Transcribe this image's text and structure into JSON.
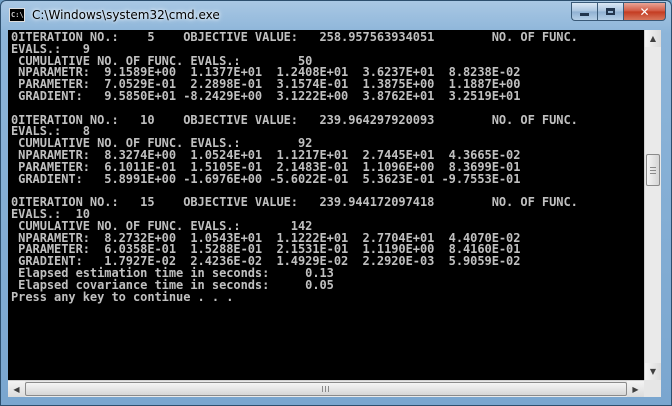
{
  "window": {
    "title": "C:\\Windows\\system32\\cmd.exe",
    "icon_label": "C:\\"
  },
  "controls": {
    "minimize": "minimize-icon",
    "maximize": "maximize-icon",
    "close": "close-icon"
  },
  "console": {
    "lines": [
      "0ITERATION NO.:    5    OBJECTIVE VALUE:   258.957563934051        NO. OF FUNC.",
      "EVALS.:   9",
      " CUMULATIVE NO. OF FUNC. EVALS.:        50",
      " NPARAMETR:  9.1589E+00  1.1377E+01  1.2408E+01  3.6237E+01  8.8238E-02",
      " PARAMETER:  7.0529E-01  2.2898E-01  3.1574E-01  1.3875E+00  1.1887E+00",
      " GRADIENT:   9.5850E+01 -8.2429E+00  3.1222E+00  3.8762E+01  3.2519E+01",
      "",
      "0ITERATION NO.:   10    OBJECTIVE VALUE:   239.964297920093        NO. OF FUNC.",
      "EVALS.:   8",
      " CUMULATIVE NO. OF FUNC. EVALS.:        92",
      " NPARAMETR:  8.3274E+00  1.0524E+01  1.1217E+01  2.7445E+01  4.3665E-02",
      " PARAMETER:  6.1011E-01  1.5105E-01  2.1483E-01  1.1096E+00  8.3699E-01",
      " GRADIENT:   5.8991E+00 -1.6976E+00 -5.6022E-01  5.3623E-01 -9.7553E-01",
      "",
      "0ITERATION NO.:   15    OBJECTIVE VALUE:   239.944172097418        NO. OF FUNC.",
      "EVALS.:  10",
      " CUMULATIVE NO. OF FUNC. EVALS.:       142",
      " NPARAMETR:  8.2732E+00  1.0543E+01  1.1222E+01  2.7704E+01  4.4070E-02",
      " PARAMETER:  6.0358E-01  1.5288E-01  2.1531E-01  1.1190E+00  8.4160E-01",
      " GRADIENT:   1.7927E-02  2.4236E-02  1.4929E-02  2.2920E-03  5.9059E-02",
      " Elapsed estimation time in seconds:     0.13",
      " Elapsed covariance time in seconds:     0.05",
      "Press any key to continue . . ."
    ]
  },
  "scrollbars": {
    "up": "▲",
    "down": "▼",
    "left": "◀",
    "right": "▶"
  }
}
